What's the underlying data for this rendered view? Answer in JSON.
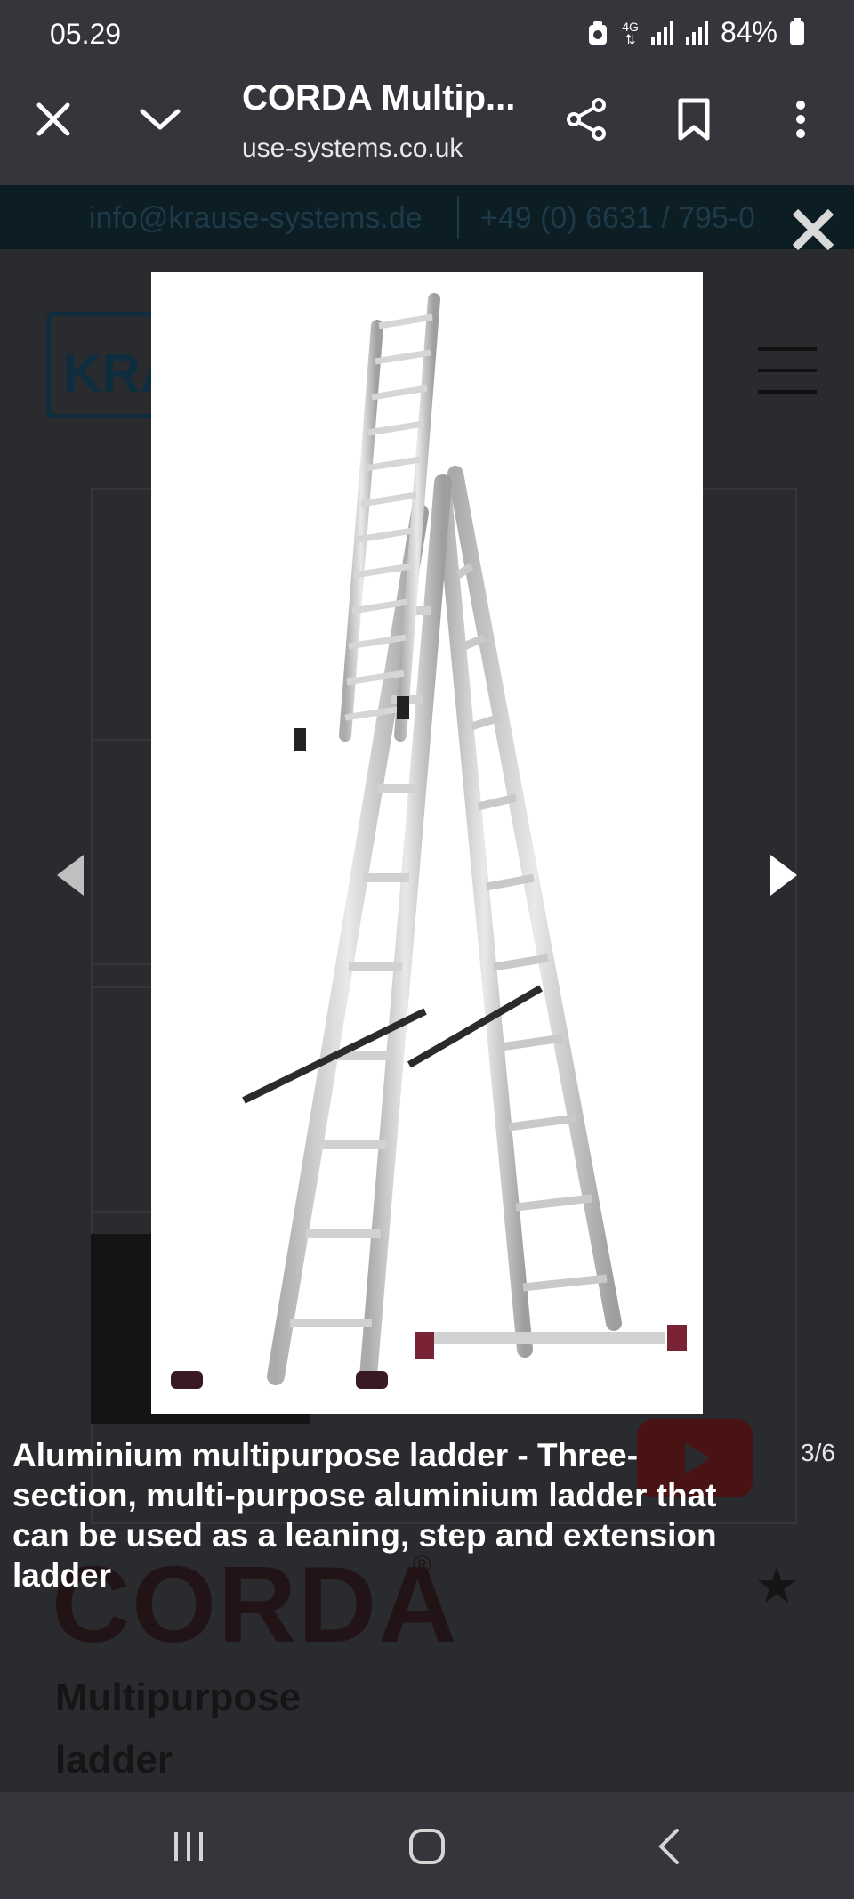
{
  "status_bar": {
    "time": "05.29",
    "network": "4G",
    "battery": "84%"
  },
  "browser": {
    "tab_title": "CORDA Multip...",
    "url": "use-systems.co.uk"
  },
  "site": {
    "email": "info@krause-systems.de",
    "phone": "+49 (0) 6631 / 795-0",
    "logo_text": "KRA",
    "brand": "CORDA",
    "brand_reg": "®",
    "subtitle": "Multipurpose\nladder"
  },
  "lightbox": {
    "caption": "Aluminium multipurpose ladder - Three-section, multi-purpose aluminium ladder that can be used as a leaning, step and extension ladder",
    "counter": "3/6",
    "image_alt": "aluminium three-section multipurpose ladder"
  },
  "colors": {
    "toolbar_bg": "#34363b",
    "overlay_bg": "#2a2b2e",
    "image_bg": "#ffffff"
  }
}
